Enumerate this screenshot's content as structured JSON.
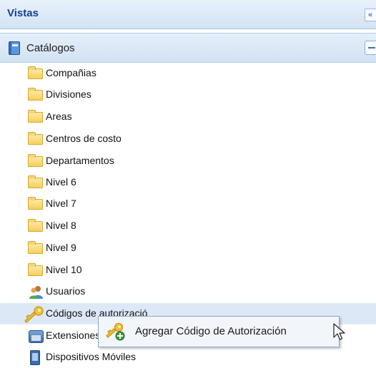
{
  "panel": {
    "title": "Vistas",
    "collapse_glyph": "«",
    "collapse_icon": "double-chevron-left-icon"
  },
  "group": {
    "label": "Catálogos",
    "icon": "book-icon",
    "toggle_icon": "minus-icon"
  },
  "tree": {
    "items": [
      {
        "label": "Compañias",
        "icon": "folder-icon"
      },
      {
        "label": "Divisiones",
        "icon": "folder-icon"
      },
      {
        "label": "Areas",
        "icon": "folder-icon"
      },
      {
        "label": "Centros de costo",
        "icon": "folder-icon"
      },
      {
        "label": "Departamentos",
        "icon": "folder-icon"
      },
      {
        "label": "Nivel 6",
        "icon": "folder-icon"
      },
      {
        "label": "Nivel 7",
        "icon": "folder-icon"
      },
      {
        "label": "Nivel 8",
        "icon": "folder-icon"
      },
      {
        "label": "Nivel 9",
        "icon": "folder-icon"
      },
      {
        "label": "Nivel 10",
        "icon": "folder-icon"
      },
      {
        "label": "Usuarios",
        "icon": "users-icon"
      },
      {
        "label": "Códigos de autorizació",
        "icon": "key-icon",
        "selected": true
      },
      {
        "label": "Extensiones",
        "icon": "phone-icon"
      },
      {
        "label": "Dispositivos Móviles",
        "icon": "mobile-device-icon"
      }
    ]
  },
  "context_menu": {
    "items": [
      {
        "label": "Agregar Código de Autorización",
        "icon": "key-add-icon"
      }
    ]
  },
  "colors": {
    "header_text": "#15428b",
    "selected_row": "#dde8f7",
    "folder": "#f6cf5e"
  }
}
